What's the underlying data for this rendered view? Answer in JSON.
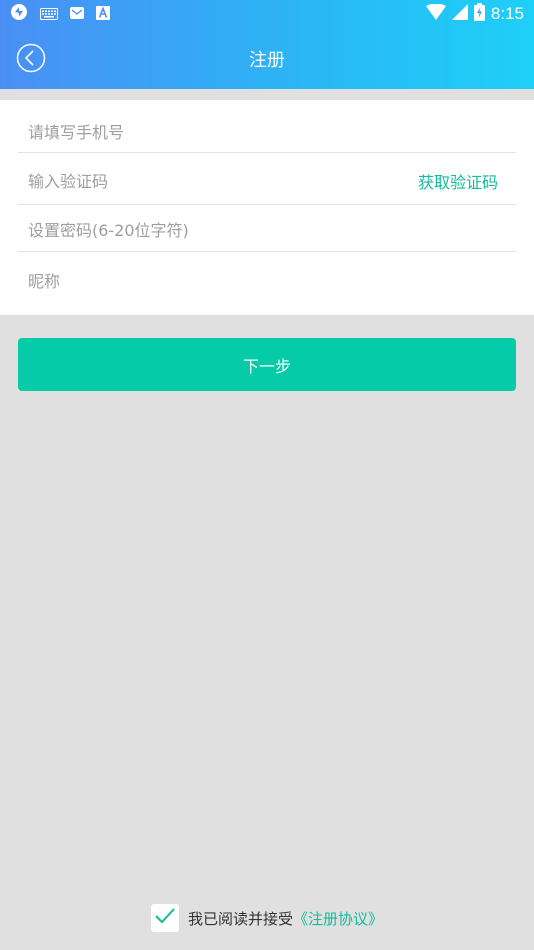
{
  "status_bar": {
    "time": "8:15",
    "left_icons": [
      "app-notification-icon",
      "keyboard-icon",
      "mail-icon",
      "text-a-icon"
    ],
    "right_icons": [
      "wifi-icon",
      "signal-icon",
      "battery-icon"
    ]
  },
  "header": {
    "title": "注册",
    "back_icon": "back-circle-icon"
  },
  "form": {
    "phone_placeholder": "请填写手机号",
    "code_placeholder": "输入验证码",
    "get_code_label": "获取验证码",
    "password_placeholder": "设置密码(6-20位字符)",
    "nickname_placeholder": "昵称"
  },
  "next_button": {
    "label": "下一步"
  },
  "agreement": {
    "checked": true,
    "text": "我已阅读并接受",
    "link": "《注册协议》"
  },
  "colors": {
    "header_gradient_start": "#4a8ff5",
    "header_gradient_end": "#1ed0f7",
    "accent": "#06cba8",
    "link": "#12bc9c",
    "background": "#e0e0e0"
  }
}
